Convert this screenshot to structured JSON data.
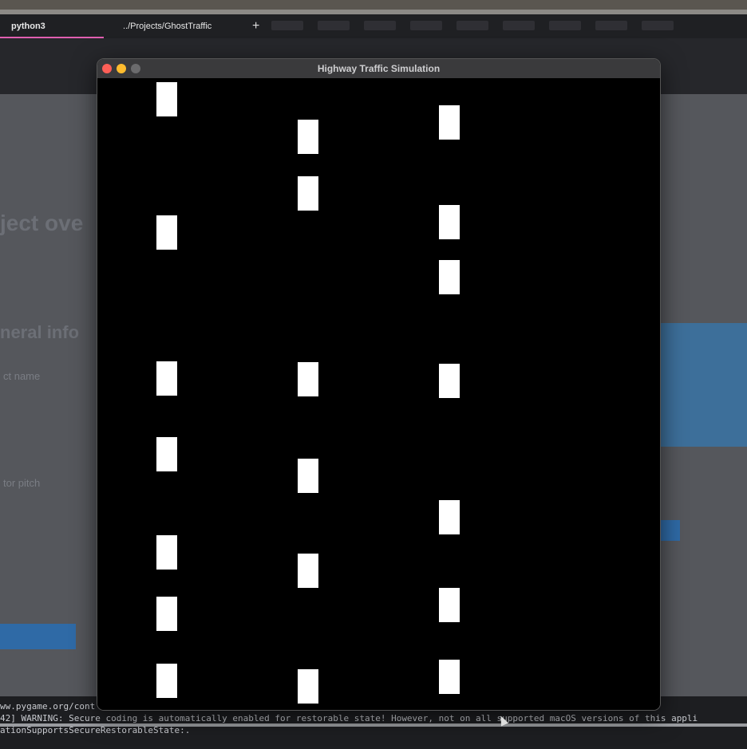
{
  "tabs": {
    "active": "python3",
    "path": "../Projects/GhostTraffic",
    "new_tab": "+"
  },
  "background": {
    "heading": "ject ove",
    "section": "neral info",
    "field1": "ct name",
    "field2": "tor pitch",
    "link": "ww.pygame.org/cont"
  },
  "terminal": {
    "line1": "42] WARNING: Secure coding is automatically enabled for restorable state! However, not on all supported macOS versions of this appli",
    "line2": "ationSupportsSecureRestorableState:."
  },
  "window": {
    "title": "Highway Traffic Simulation"
  },
  "simulation": {
    "lanes": 3,
    "car_color": "#ffffff",
    "road_color": "#000000",
    "cars_per_lane": [
      7,
      6,
      7
    ]
  },
  "colors": {
    "close": "#fe5f57",
    "minimize": "#febc2e",
    "accent_tab": "#e05fb0"
  }
}
